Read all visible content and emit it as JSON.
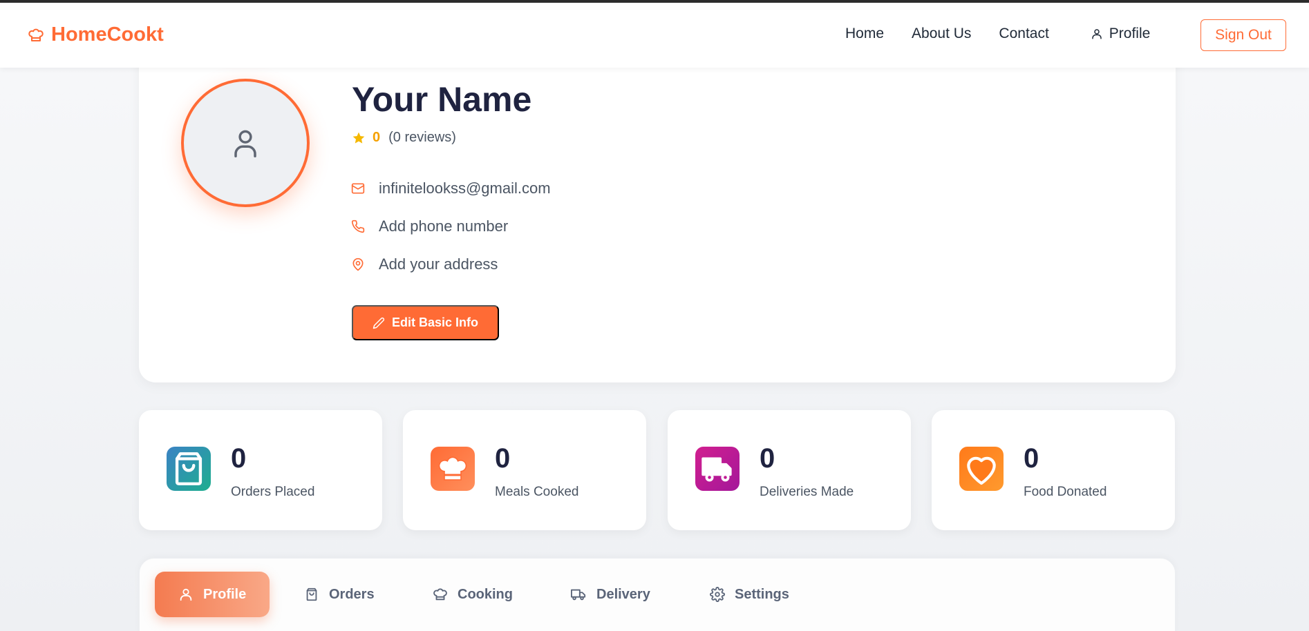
{
  "nav": {
    "brand": "HomeCookt",
    "links": [
      "Home",
      "About Us",
      "Contact"
    ],
    "profile_label": "Profile",
    "signout_label": "Sign Out"
  },
  "profile": {
    "name": "Your Name",
    "rating_value": "0",
    "rating_count": "(0 reviews)",
    "email": "infinitelookss@gmail.com",
    "phone": "Add phone number",
    "address": "Add your address",
    "edit_label": "Edit Basic Info"
  },
  "stats": [
    {
      "value": "0",
      "label": "Orders Placed",
      "icon": "shopping-bag-icon"
    },
    {
      "value": "0",
      "label": "Meals Cooked",
      "icon": "chef-hat-icon"
    },
    {
      "value": "0",
      "label": "Deliveries Made",
      "icon": "truck-icon"
    },
    {
      "value": "0",
      "label": "Food Donated",
      "icon": "heart-icon"
    }
  ],
  "tabs": [
    {
      "label": "Profile",
      "icon": "user-icon",
      "active": true
    },
    {
      "label": "Orders",
      "icon": "shopping-bag-icon",
      "active": false
    },
    {
      "label": "Cooking",
      "icon": "chef-hat-icon",
      "active": false
    },
    {
      "label": "Delivery",
      "icon": "truck-icon",
      "active": false
    },
    {
      "label": "Settings",
      "icon": "gear-icon",
      "active": false
    }
  ],
  "colors": {
    "accent": "#ff6b35",
    "rating": "#f5a000",
    "heading": "#1f2340"
  }
}
